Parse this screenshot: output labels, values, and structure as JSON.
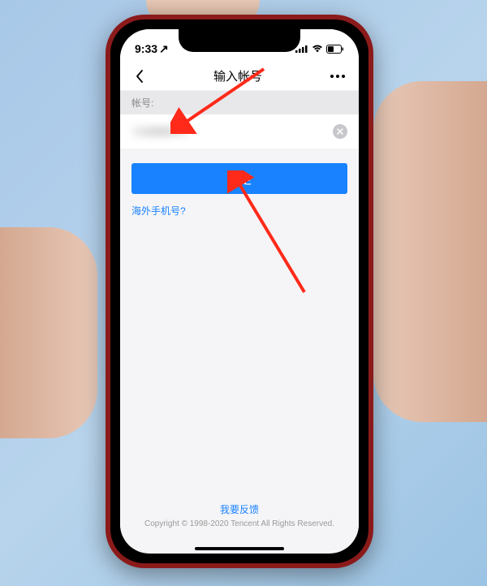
{
  "status": {
    "time": "9:33",
    "arrow_glyph": "↗"
  },
  "nav": {
    "title": "输入帐号"
  },
  "form": {
    "account_label": "帐号:",
    "confirm_label": "确定",
    "overseas_link": "海外手机号?"
  },
  "footer": {
    "feedback_link": "我要反馈",
    "copyright": "Copyright © 1998-2020 Tencent All Rights Reserved."
  },
  "colors": {
    "primary": "#1982ff",
    "link": "#1982ff",
    "bg": "#f5f5f7"
  }
}
